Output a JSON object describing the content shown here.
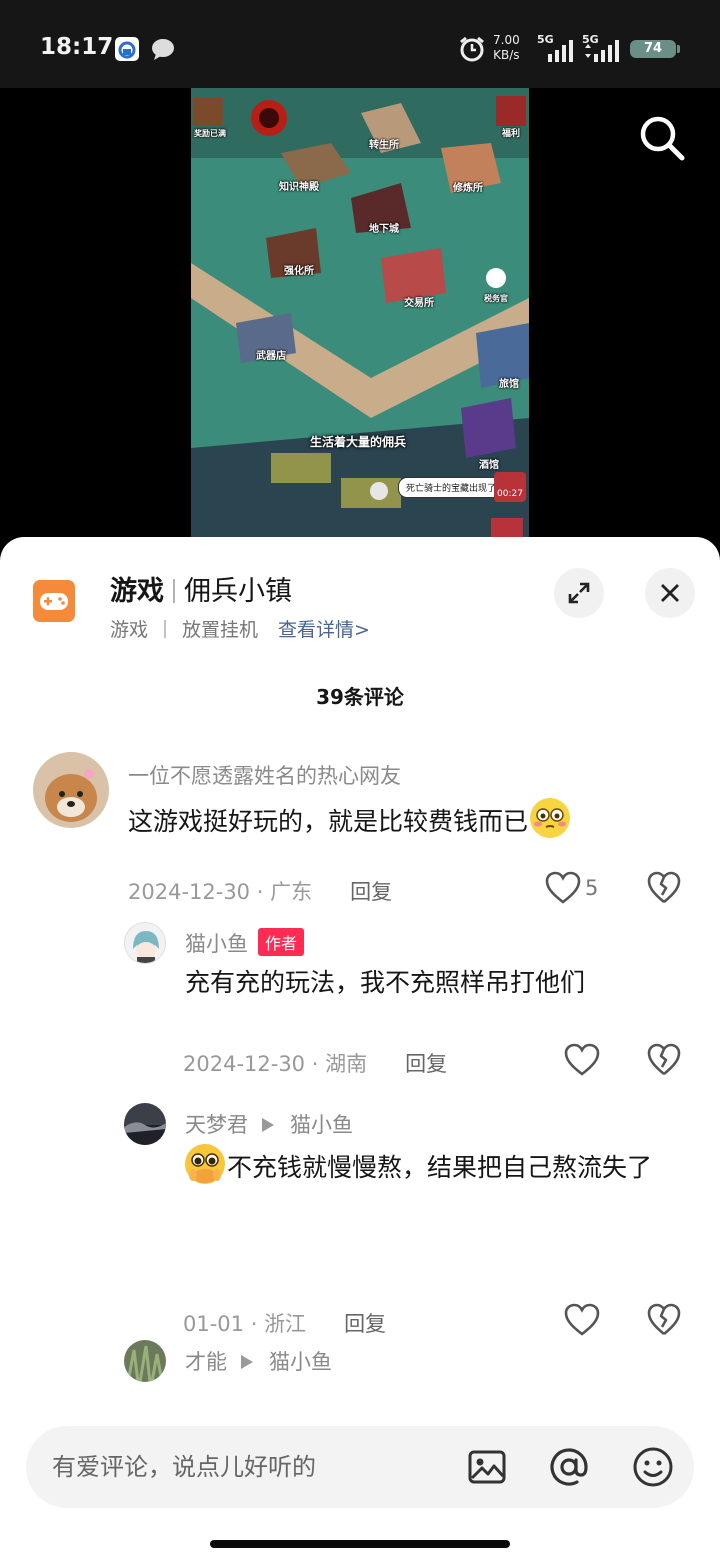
{
  "status_bar": {
    "time": "18:17",
    "net_speed_value": "7.00",
    "net_speed_unit": "KB/s",
    "signal1_label": "5G",
    "signal2_label": "5G",
    "battery": "74",
    "icons": [
      "app-notification-icon",
      "chat-bubble-icon",
      "alarm-icon",
      "signal-icon",
      "battery-icon"
    ]
  },
  "video": {
    "buildings": [
      "转生所",
      "知识神殿",
      "修炼所",
      "地下城",
      "强化所",
      "交易所",
      "税务官",
      "武器店",
      "旅馆",
      "酒馆"
    ],
    "top_left_badge": "奖励已满",
    "top_right_badge": "福利",
    "caption": "生活着大量的佣兵",
    "speech_bubble": "死亡骑士的宝藏出现了",
    "timer": "00:27"
  },
  "game_card": {
    "category": "游戏",
    "name": "佣兵小镇",
    "tag1": "游戏",
    "tag2": "放置挂机",
    "detail_link": "查看详情>"
  },
  "comments_header": {
    "count_text": "39条评论"
  },
  "comments": [
    {
      "username": "一位不愿透露姓名的热心网友",
      "text": "这游戏挺好玩的，就是比较费钱而已",
      "date": "2024-12-30",
      "location": "广东",
      "reply_label": "回复",
      "likes": "5"
    },
    {
      "username": "猫小鱼",
      "badge": "作者",
      "text": "充有充的玩法，我不充照样吊打他们",
      "date": "2024-12-30",
      "location": "湖南",
      "reply_label": "回复"
    },
    {
      "username": "天梦君",
      "reply_to": "猫小鱼",
      "text": "不充钱就慢慢熬，结果把自己熬流失了",
      "date": "01-01",
      "location": "浙江",
      "reply_label": "回复"
    },
    {
      "username": "才能",
      "reply_to": "猫小鱼"
    }
  ],
  "input": {
    "placeholder": "有爱评论，说点儿好听的",
    "icons": [
      "image-icon",
      "at-icon",
      "emoji-icon"
    ]
  },
  "colors": {
    "accent_red": "#fe2c55",
    "link_blue": "#4a6590",
    "game_icon_orange": "#f58b3a"
  }
}
